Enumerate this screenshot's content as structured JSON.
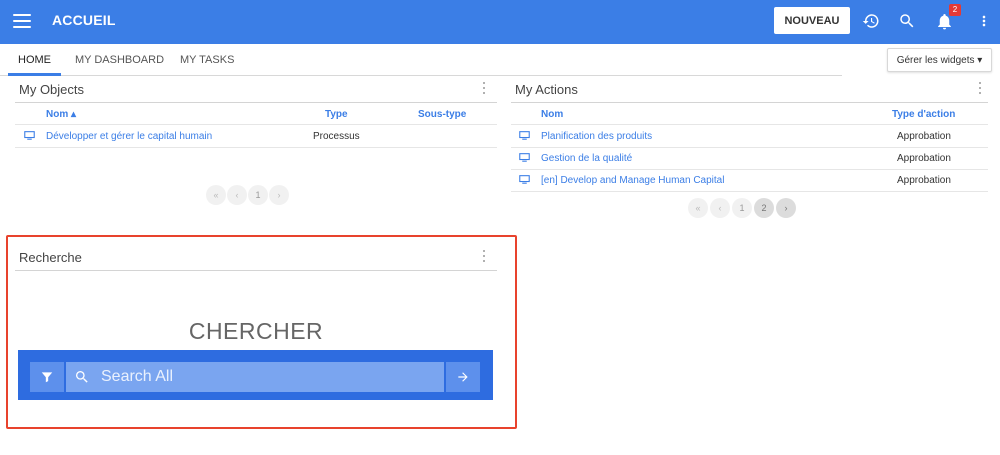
{
  "header": {
    "title": "ACCUEIL",
    "new_button": "NOUVEAU",
    "notification_count": "2",
    "colors": {
      "bar": "#3b7ee6",
      "badge": "#e53935"
    },
    "icons": [
      "menu-icon",
      "history-icon",
      "search-icon",
      "bell-icon",
      "more-vert-icon"
    ]
  },
  "tabs": [
    {
      "label": "HOME",
      "active": true
    },
    {
      "label": "MY DASHBOARD",
      "active": false
    },
    {
      "label": "MY TASKS",
      "active": false
    }
  ],
  "manage_widgets": "Gérer les widgets ▾",
  "my_objects": {
    "title": "My Objects",
    "columns": {
      "name": "Nom ▴",
      "type": "Type",
      "subtype": "Sous-type"
    },
    "rows": [
      {
        "name": "Développer et gérer le capital humain",
        "type": "Processus",
        "subtype": ""
      }
    ],
    "pagination": {
      "first": "«",
      "prev": "‹",
      "page": "1",
      "next": "›"
    }
  },
  "my_actions": {
    "title": "My Actions",
    "columns": {
      "name": "Nom",
      "action_type": "Type d'action"
    },
    "rows": [
      {
        "name": "Planification des produits",
        "action_type": "Approbation"
      },
      {
        "name": "Gestion de la qualité",
        "action_type": "Approbation"
      },
      {
        "name": "[en] Develop and Manage Human Capital",
        "action_type": "Approbation"
      }
    ],
    "pagination": {
      "first": "«",
      "prev": "‹",
      "page1": "1",
      "page2": "2",
      "next": "›"
    }
  },
  "recherche": {
    "title": "Recherche",
    "heading": "CHERCHER",
    "placeholder": "Search All",
    "highlight_color": "#e8432d"
  }
}
